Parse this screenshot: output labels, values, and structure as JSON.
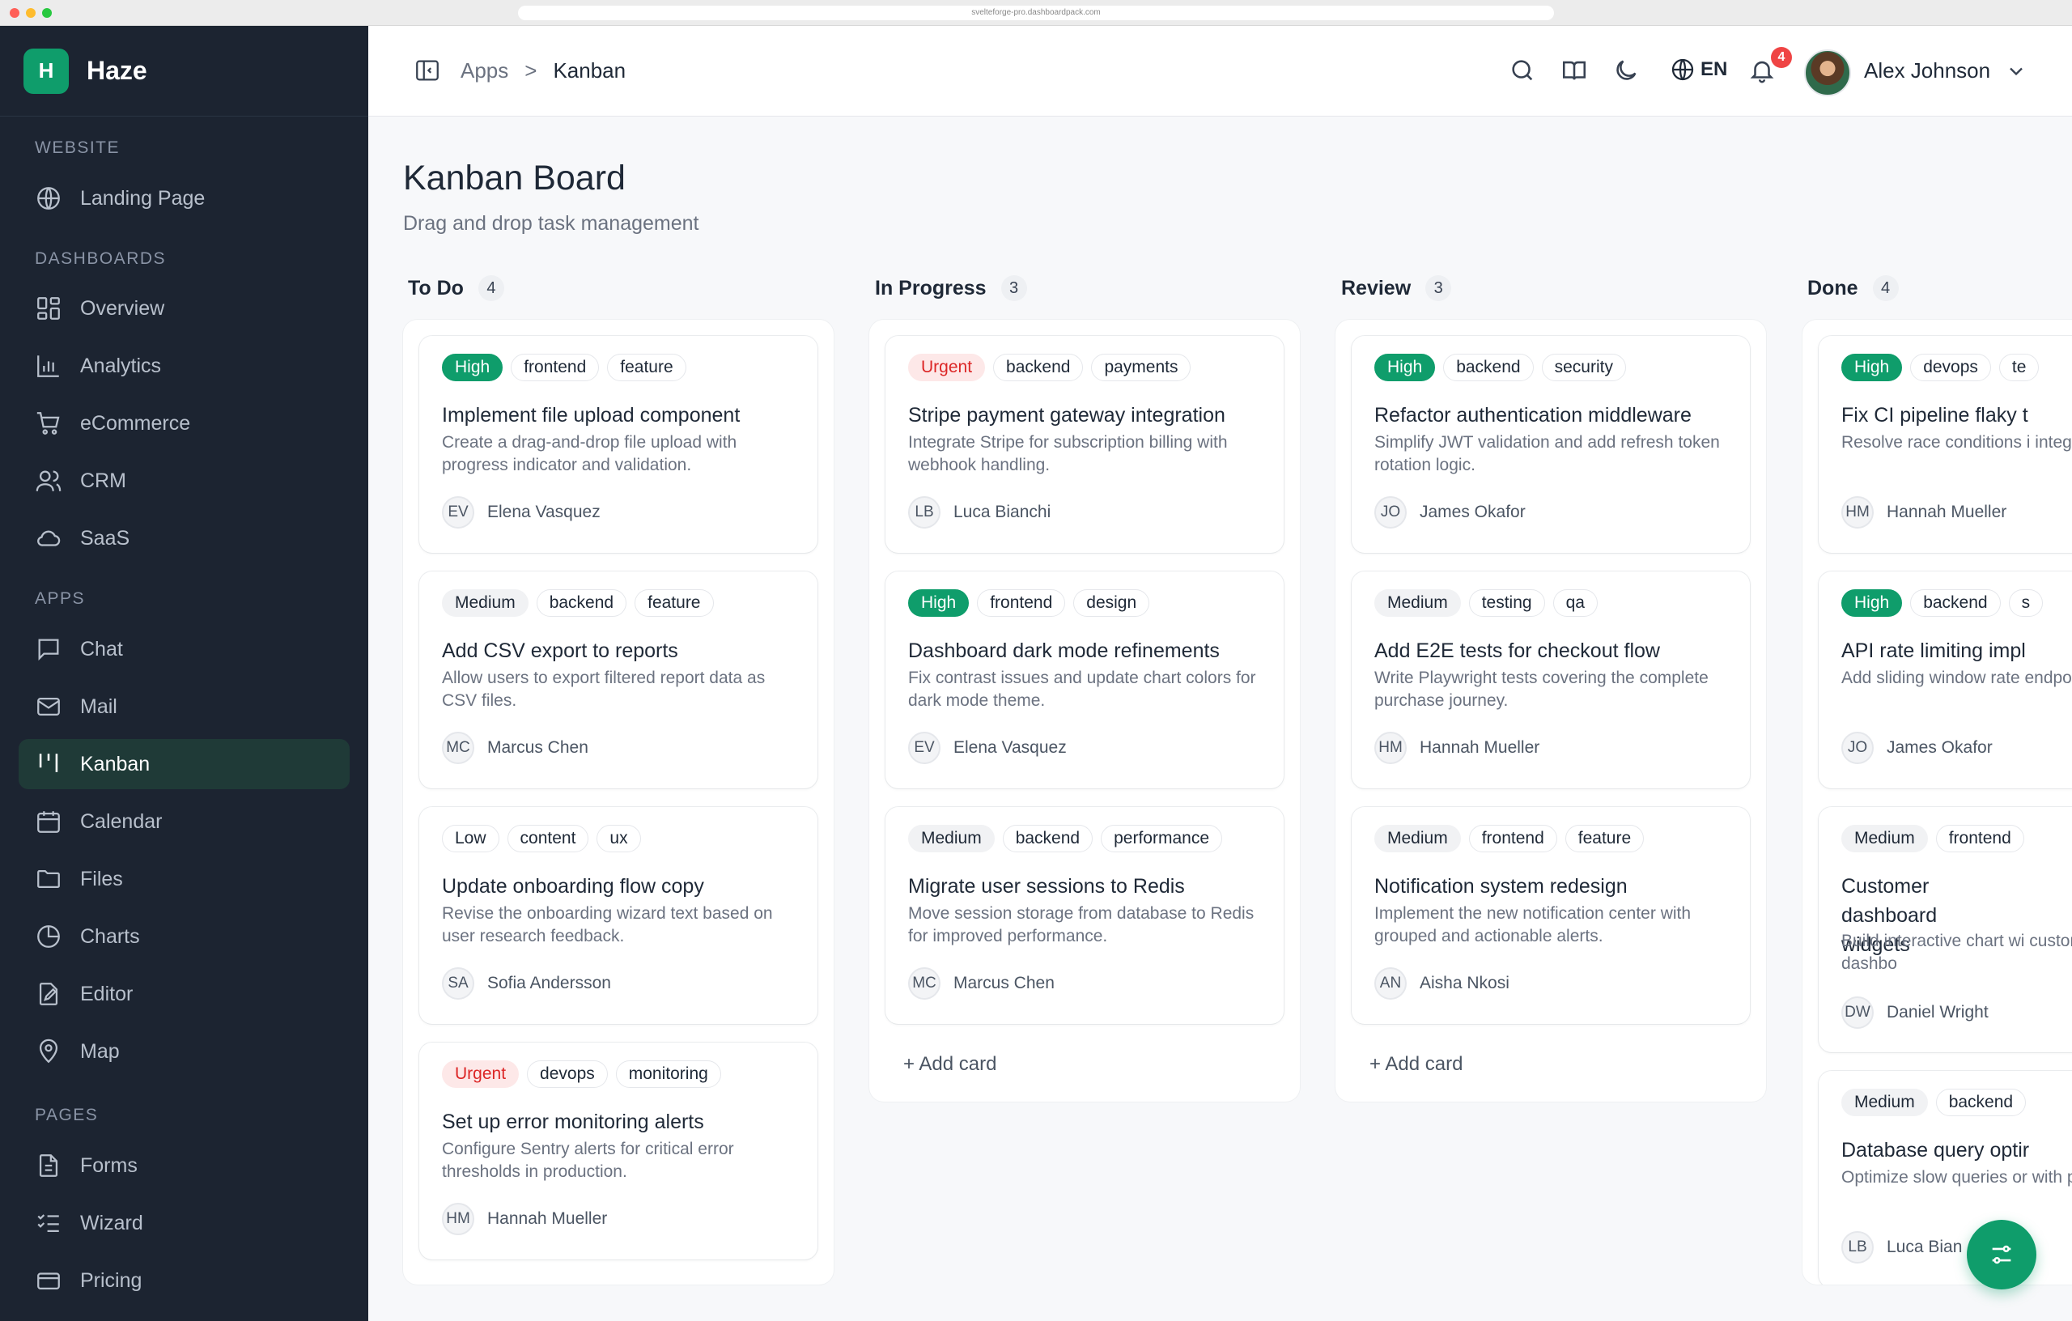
{
  "browser": {
    "url": "svelteforge-pro.dashboardpack.com"
  },
  "sidebar": {
    "logo_letter": "H",
    "brand": "Haze",
    "sections": {
      "website": "WEBSITE",
      "dashboards": "DASHBOARDS",
      "apps": "APPS",
      "pages": "PAGES"
    },
    "items": {
      "landing": "Landing Page",
      "overview": "Overview",
      "analytics": "Analytics",
      "ecommerce": "eCommerce",
      "crm": "CRM",
      "saas": "SaaS",
      "chat": "Chat",
      "mail": "Mail",
      "kanban": "Kanban",
      "calendar": "Calendar",
      "files": "Files",
      "charts": "Charts",
      "editor": "Editor",
      "map": "Map",
      "forms": "Forms",
      "wizard": "Wizard",
      "pricing": "Pricing"
    },
    "active": "Kanban"
  },
  "header": {
    "breadcrumb": {
      "parent": "Apps",
      "separator": ">",
      "current": "Kanban"
    },
    "language": "EN",
    "notification_count": "4",
    "user_name": "Alex Johnson"
  },
  "page": {
    "title": "Kanban Board",
    "subtitle": "Drag and drop task management"
  },
  "board": {
    "add_card_label": "+ Add card",
    "columns": [
      {
        "title": "To Do",
        "count": "4",
        "cards": [
          {
            "priority": "High",
            "tags": [
              "frontend",
              "feature"
            ],
            "title": "Implement file upload component",
            "description": "Create a drag-and-drop file upload with progress indicator and validation.",
            "initials": "EV",
            "assignee": "Elena Vasquez"
          },
          {
            "priority": "Medium",
            "tags": [
              "backend",
              "feature"
            ],
            "title": "Add CSV export to reports",
            "description": "Allow users to export filtered report data as CSV files.",
            "initials": "MC",
            "assignee": "Marcus Chen"
          },
          {
            "priority": "Low",
            "tags": [
              "content",
              "ux"
            ],
            "title": "Update onboarding flow copy",
            "description": "Revise the onboarding wizard text based on user research feedback.",
            "initials": "SA",
            "assignee": "Sofia Andersson"
          },
          {
            "priority": "Urgent",
            "tags": [
              "devops",
              "monitoring"
            ],
            "title": "Set up error monitoring alerts",
            "description": "Configure Sentry alerts for critical error thresholds in production.",
            "initials": "HM",
            "assignee": "Hannah Mueller"
          }
        ]
      },
      {
        "title": "In Progress",
        "count": "3",
        "cards": [
          {
            "priority": "Urgent",
            "tags": [
              "backend",
              "payments"
            ],
            "title": "Stripe payment gateway integration",
            "description": "Integrate Stripe for subscription billing with webhook handling.",
            "initials": "LB",
            "assignee": "Luca Bianchi"
          },
          {
            "priority": "High",
            "tags": [
              "frontend",
              "design"
            ],
            "title": "Dashboard dark mode refinements",
            "description": "Fix contrast issues and update chart colors for dark mode theme.",
            "initials": "EV",
            "assignee": "Elena Vasquez"
          },
          {
            "priority": "Medium",
            "tags": [
              "backend",
              "performance"
            ],
            "title": "Migrate user sessions to Redis",
            "description": "Move session storage from database to Redis for improved performance.",
            "initials": "MC",
            "assignee": "Marcus Chen"
          }
        ]
      },
      {
        "title": "Review",
        "count": "3",
        "cards": [
          {
            "priority": "High",
            "tags": [
              "backend",
              "security"
            ],
            "title": "Refactor authentication middleware",
            "description": "Simplify JWT validation and add refresh token rotation logic.",
            "initials": "JO",
            "assignee": "James Okafor"
          },
          {
            "priority": "Medium",
            "tags": [
              "testing",
              "qa"
            ],
            "title": "Add E2E tests for checkout flow",
            "description": "Write Playwright tests covering the complete purchase journey.",
            "initials": "HM",
            "assignee": "Hannah Mueller"
          },
          {
            "priority": "Medium",
            "tags": [
              "frontend",
              "feature"
            ],
            "title": "Notification system redesign",
            "description": "Implement the new notification center with grouped and actionable alerts.",
            "initials": "AN",
            "assignee": "Aisha Nkosi"
          }
        ]
      },
      {
        "title": "Done",
        "count": "4",
        "cards": [
          {
            "priority": "High",
            "tags": [
              "devops",
              "te"
            ],
            "title": "Fix CI pipeline flaky t",
            "description": "Resolve race conditions i integration tests.",
            "initials": "HM",
            "assignee": "Hannah Mueller"
          },
          {
            "priority": "High",
            "tags": [
              "backend",
              "s"
            ],
            "title": "API rate limiting impl",
            "description": "Add sliding window rate endpoint configuration.",
            "initials": "JO",
            "assignee": "James Okafor"
          },
          {
            "priority": "Medium",
            "tags": [
              "frontend"
            ],
            "title": "Customer dashboard widgets",
            "description": "Build interactive chart wi customer-facing dashbo",
            "initials": "DW",
            "assignee": "Daniel Wright"
          },
          {
            "priority": "Medium",
            "tags": [
              "backend"
            ],
            "title": "Database query optir",
            "description": "Optimize slow queries or with proper indexing.",
            "initials": "LB",
            "assignee": "Luca Bian"
          }
        ]
      }
    ]
  },
  "colors": {
    "accent": "#0f9d6b",
    "sidebar_bg": "#1c2431",
    "urgent": "#dc2626",
    "badge": "#ef4444"
  },
  "icons": {
    "fab": "sliders-icon"
  }
}
